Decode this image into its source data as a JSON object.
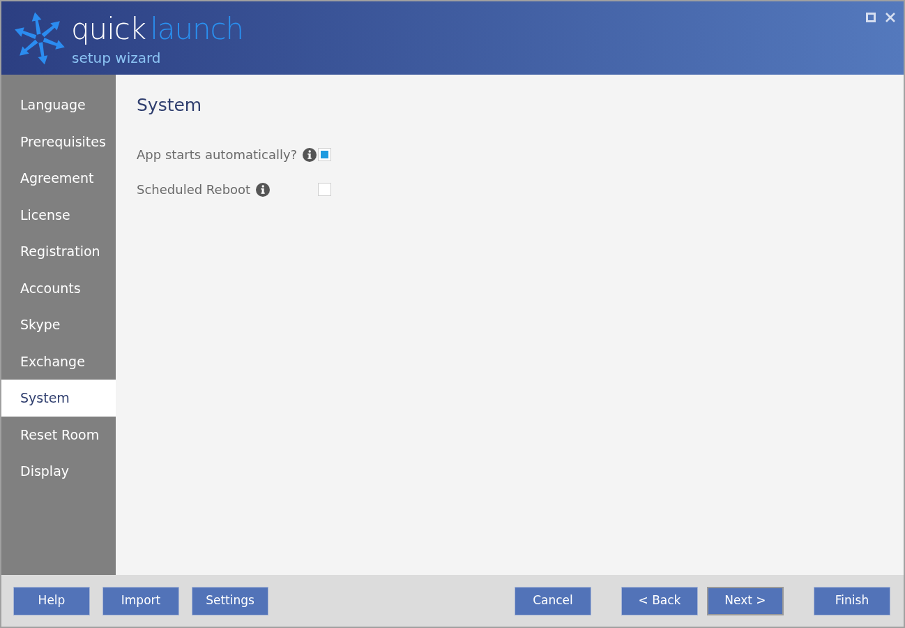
{
  "header": {
    "title_main": "quick",
    "title_accent": "launch",
    "subtitle": "setup wizard"
  },
  "sidebar": {
    "items": [
      {
        "label": "Language",
        "selected": false
      },
      {
        "label": "Prerequisites",
        "selected": false
      },
      {
        "label": "Agreement",
        "selected": false
      },
      {
        "label": "License",
        "selected": false
      },
      {
        "label": "Registration",
        "selected": false
      },
      {
        "label": "Accounts",
        "selected": false
      },
      {
        "label": "Skype",
        "selected": false
      },
      {
        "label": "Exchange",
        "selected": false
      },
      {
        "label": "System",
        "selected": true
      },
      {
        "label": "Reset Room",
        "selected": false
      },
      {
        "label": "Display",
        "selected": false
      }
    ]
  },
  "content": {
    "heading": "System",
    "options": [
      {
        "label": "App starts automatically?",
        "checked": true
      },
      {
        "label": "Scheduled Reboot",
        "checked": false
      }
    ]
  },
  "footer": {
    "left_buttons": [
      {
        "label": "Help",
        "focused": false
      },
      {
        "label": "Import",
        "focused": false
      },
      {
        "label": "Settings",
        "focused": false
      }
    ],
    "right_buttons": [
      {
        "label": "Cancel",
        "focused": false
      },
      {
        "label": "< Back",
        "focused": false
      },
      {
        "label": "Next >",
        "focused": true
      },
      {
        "label": "Finish",
        "focused": false
      }
    ]
  }
}
